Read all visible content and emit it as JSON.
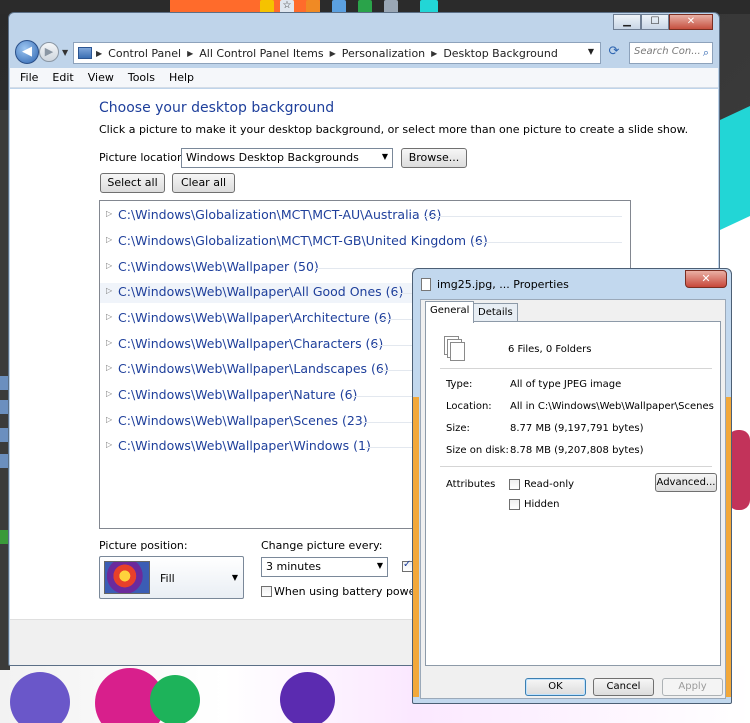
{
  "window": {
    "address_breadcrumbs": [
      "Control Panel",
      "All Control Panel Items",
      "Personalization",
      "Desktop Background"
    ],
    "search_placeholder": "Search Con...",
    "caption_buttons": {
      "minimize": "▁",
      "maximize": "☐",
      "close": "✕"
    }
  },
  "menu": [
    "File",
    "Edit",
    "View",
    "Tools",
    "Help"
  ],
  "page": {
    "title": "Choose your desktop background",
    "lead": "Click a picture to make it your desktop background, or select more than one picture to create a slide show.",
    "picture_location_label": "Picture location:",
    "picture_location_value": "Windows Desktop Backgrounds",
    "browse_label": "Browse...",
    "select_all_label": "Select all",
    "clear_all_label": "Clear all",
    "folders": [
      "C:\\Windows\\Globalization\\MCT\\MCT-AU\\Australia (6)",
      "C:\\Windows\\Globalization\\MCT\\MCT-GB\\United Kingdom (6)",
      "C:\\Windows\\Web\\Wallpaper (50)",
      "C:\\Windows\\Web\\Wallpaper\\All Good Ones (6)",
      "C:\\Windows\\Web\\Wallpaper\\Architecture (6)",
      "C:\\Windows\\Web\\Wallpaper\\Characters (6)",
      "C:\\Windows\\Web\\Wallpaper\\Landscapes (6)",
      "C:\\Windows\\Web\\Wallpaper\\Nature (6)",
      "C:\\Windows\\Web\\Wallpaper\\Scenes (23)",
      "C:\\Windows\\Web\\Wallpaper\\Windows (1)"
    ],
    "picture_position_label": "Picture position:",
    "picture_position_value": "Fill",
    "change_picture_label": "Change picture every:",
    "change_picture_value": "3 minutes",
    "battery_label": "When using battery power, pau"
  },
  "dialog": {
    "title": "img25.jpg, ... Properties",
    "close_label": "✕",
    "tabs": [
      "General",
      "Details"
    ],
    "summary": "6 Files, 0 Folders",
    "type_label": "Type:",
    "type_value": "All of type JPEG image",
    "location_label": "Location:",
    "location_value": "All in C:\\Windows\\Web\\Wallpaper\\Scenes",
    "size_label": "Size:",
    "size_value": "8.77 MB (9,197,791 bytes)",
    "size_on_disk_label": "Size on disk:",
    "size_on_disk_value": "8.78 MB (9,207,808 bytes)",
    "attributes_label": "Attributes",
    "readonly_label": "Read-only",
    "hidden_label": "Hidden",
    "advanced_label": "Advanced...",
    "ok_label": "OK",
    "cancel_label": "Cancel",
    "apply_label": "Apply"
  }
}
